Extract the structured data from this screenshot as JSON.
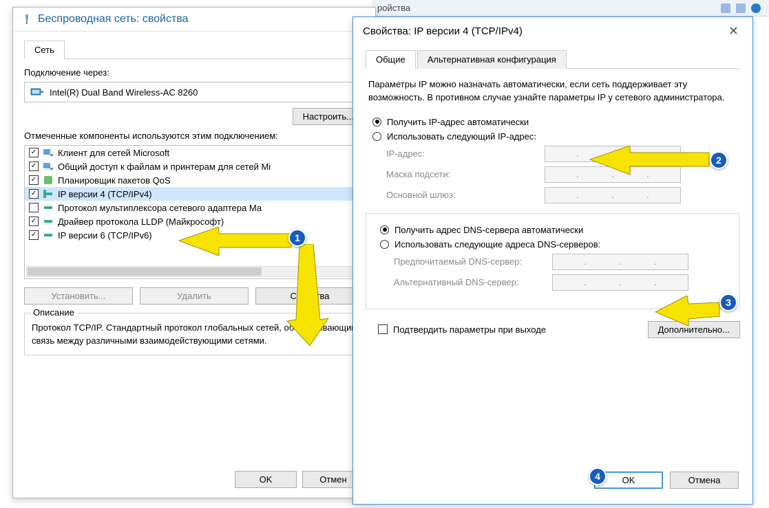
{
  "bgbar": {
    "text": "ройства"
  },
  "w1": {
    "title": "Беспроводная сеть: свойства",
    "tab": "Сеть",
    "conn_label": "Подключение через:",
    "adapter": "Intel(R) Dual Band Wireless-AC 8260",
    "configure_btn": "Настроить...",
    "components_label": "Отмеченные компоненты используются этим подключением:",
    "items": [
      {
        "checked": true,
        "label": "Клиент для сетей Microsoft"
      },
      {
        "checked": true,
        "label": "Общий доступ к файлам и принтерам для сетей Mi"
      },
      {
        "checked": true,
        "label": "Планировщик пакетов QoS"
      },
      {
        "checked": true,
        "label": "IP версии 4 (TCP/IPv4)",
        "selected": true
      },
      {
        "checked": false,
        "label": "Протокол мультиплексора сетевого адаптера Ма"
      },
      {
        "checked": true,
        "label": "Драйвер протокола LLDP (Майкрософт)"
      },
      {
        "checked": true,
        "label": "IP версии 6 (TCP/IPv6)"
      }
    ],
    "install_btn": "Установить...",
    "remove_btn": "Удалить",
    "props_btn": "Свойства",
    "desc_legend": "Описание",
    "desc_text": "Протокол TCP/IP. Стандартный протокол глобальных сетей, обеспечивающий связь между различными взаимодействующими сетями.",
    "ok": "OK",
    "cancel": "Отмен"
  },
  "w2": {
    "title": "Свойства: IP версии 4 (TCP/IPv4)",
    "tabs": {
      "general": "Общие",
      "alt": "Альтернативная конфигурация"
    },
    "intro": "Параметры IP можно назначать автоматически, если сеть поддерживает эту возможность. В противном случае узнайте параметры IP у сетевого администратора.",
    "ip_auto": "Получить IP-адрес автоматически",
    "ip_manual": "Использовать следующий IP-адрес:",
    "ip_fields": {
      "ip": "IP-адрес:",
      "mask": "Маска подсети:",
      "gw": "Основной шлюз:"
    },
    "dns_auto": "Получить адрес DNS-сервера автоматически",
    "dns_manual": "Использовать следующие адреса DNS-серверов:",
    "dns_fields": {
      "pref": "Предпочитаемый DNS-сервер:",
      "alt": "Альтернативный DNS-сервер:"
    },
    "confirm_exit": "Подтвердить параметры при выходе",
    "advanced": "Дополнительно...",
    "ok": "OK",
    "cancel": "Отмена"
  },
  "badges": {
    "b1": "1",
    "b2": "2",
    "b3": "3",
    "b4": "4"
  }
}
